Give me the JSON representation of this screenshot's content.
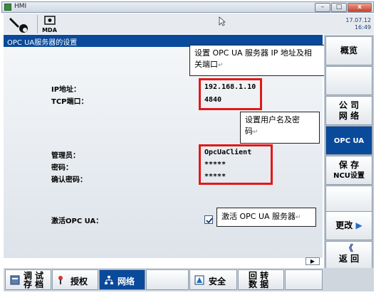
{
  "window": {
    "title": "HMI"
  },
  "header": {
    "mode_label": "MDA",
    "date": "17.07.12",
    "time": "16:49"
  },
  "panel": {
    "title": "OPC UA服务器的设置"
  },
  "fields": {
    "ip_label": "IP地址：",
    "ip_value": "192.168.1.10",
    "tcp_label": "TCP端口：",
    "tcp_value": "4840",
    "admin_label": "管理员：",
    "admin_value": "OpcUaClient",
    "password_label": "密码：",
    "password_value": "*****",
    "confirm_label": "确认密码：",
    "confirm_value": "*****",
    "activate_label": "激活OPC UA：",
    "activate_checked": true
  },
  "callouts": {
    "ip_note_line1": "设置 OPC  UA 服务器 IP 地址及相",
    "ip_note_line2": "关端口",
    "user_note_line1": "设置用户名及密",
    "user_note_line2": "码",
    "activate_note": "激活 OPC UA 服务器",
    "return_mark": "↵"
  },
  "right_softkeys": {
    "overview": "概览",
    "company_l1": "公 司",
    "company_l2": "网 络",
    "opcua": "OPC UA",
    "save_l1": "保 存",
    "save_l2": "NCU设置",
    "change": "更改",
    "back_arrows": "《",
    "back": "返 回"
  },
  "bottom_bar": {
    "debug_l1": "调 试",
    "debug_l2": "存 档",
    "auth": "授权",
    "network": "网络",
    "security": "安全",
    "rotary_l1": "回 转",
    "rotary_l2": "数 据"
  },
  "colors": {
    "accent_blue": "#0a4a9b",
    "highlight_red": "#e01919"
  }
}
